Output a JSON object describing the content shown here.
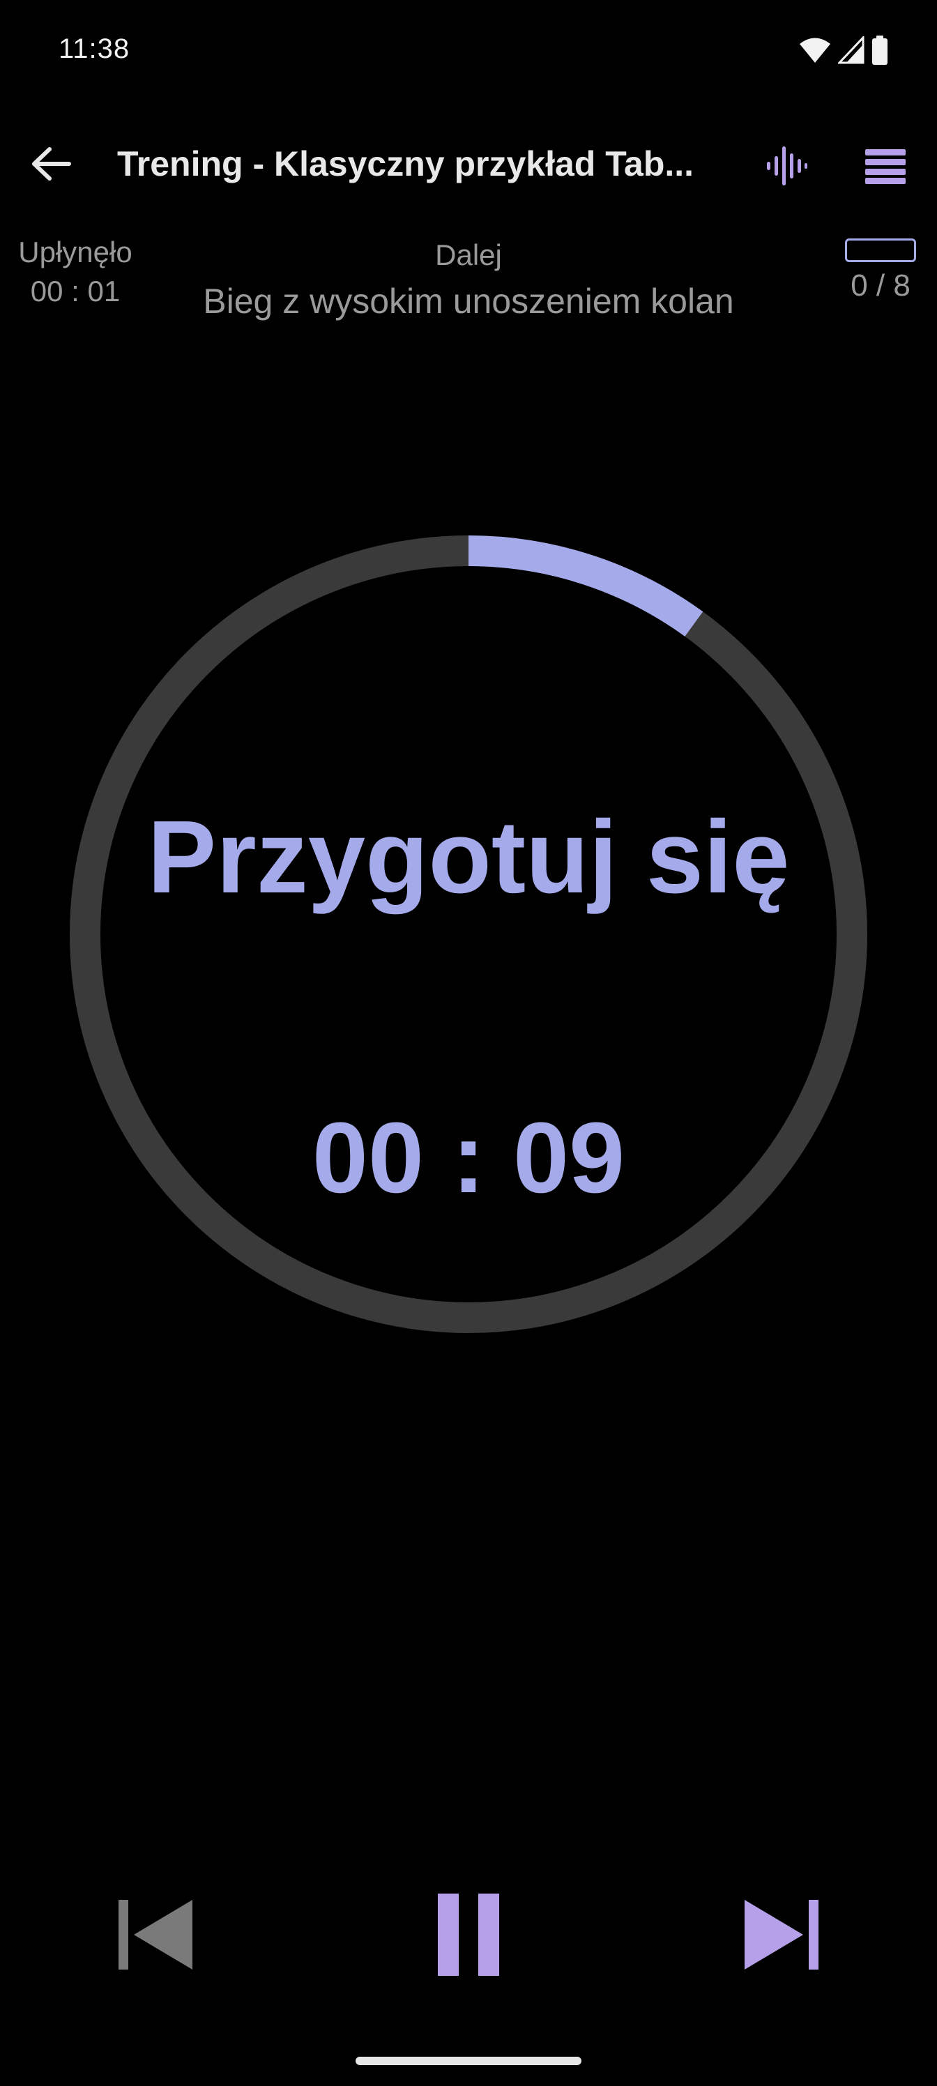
{
  "status_bar": {
    "time": "11:38",
    "icons": [
      "wifi-icon",
      "cell-signal-icon",
      "battery-icon"
    ]
  },
  "app_bar": {
    "title": "Trening - Klasyczny przykład Tab...",
    "back_icon": "arrow-left-icon",
    "voice_icon": "sound-wave-icon",
    "menu_icon": "menu-icon"
  },
  "info": {
    "elapsed_label": "Upłynęło",
    "elapsed_value": "00 : 01",
    "next_label": "Dalej",
    "next_exercise": "Bieg z wysokim unoszeniem kolan",
    "progress_text": "0 / 8",
    "progress_fraction": 0
  },
  "timer": {
    "phase_label": "Przygotuj się",
    "countdown": "00 : 09",
    "ring_progress": 0.1
  },
  "controls": {
    "prev_icon": "skip-previous-icon",
    "pause_icon": "pause-icon",
    "next_icon": "skip-next-icon"
  },
  "colors": {
    "accent": "#a4aaea",
    "icon_accent": "#b7a0ea",
    "ring_track": "#3a3a3a",
    "muted_text": "#9a9a9a",
    "background": "#000000"
  }
}
